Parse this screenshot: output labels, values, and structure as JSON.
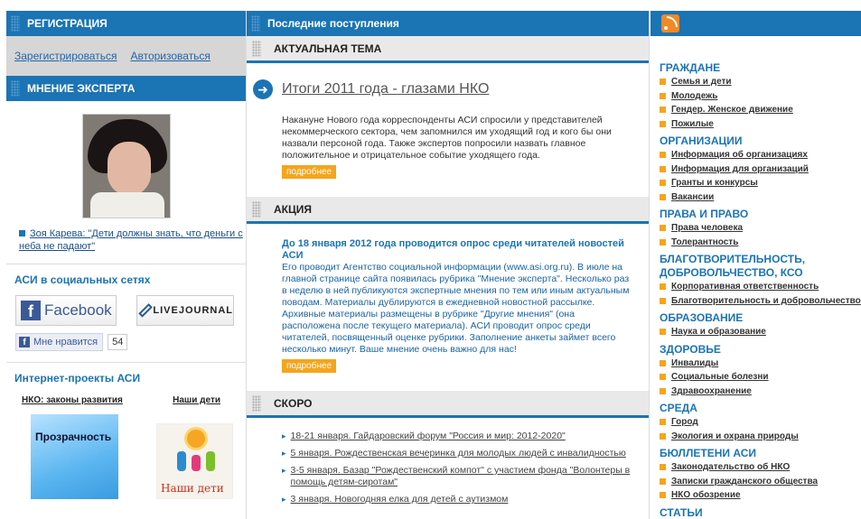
{
  "left": {
    "registration": {
      "title": "РЕГИСТРАЦИЯ",
      "register_link": "Зарегистрироваться",
      "login_link": "Авторизоваться"
    },
    "expert": {
      "title": "МНЕНИЕ ЭКСПЕРТА",
      "quote_link": "Зоя Карева: \"Дети должны знать, что деньги с неба не падают\""
    },
    "social": {
      "title": "АСИ в социальных сетях",
      "facebook_label": "Facebook",
      "livejournal_label": "LIVEJOURNAL",
      "like_label": "Мне нравится",
      "like_count": "54"
    },
    "projects": {
      "title": "Интернет-проекты АСИ",
      "link1": "НКО: законы развития",
      "link2": "Наши дети",
      "image1_text": "Прозрачность",
      "image2_text": "Наши дети"
    }
  },
  "middle": {
    "header": "Последние поступления",
    "topic": {
      "section": "АКТУАЛЬНАЯ ТЕМА",
      "title": "Итоги 2011 года - глазами НКО",
      "text": "Накануне Нового года корреспонденты АСИ спросили у представителей некоммерческого сектора, чем запомнился им уходящий год и кого бы они назвали персоной года. Также экспертов попросили назвать главное положительное и отрицательное событие уходящего года.",
      "more": "подробнее"
    },
    "action": {
      "section": "АКЦИЯ",
      "headline": "До 18 января 2012 года проводится опрос среди читателей новостей АСИ",
      "text": "Его проводит Агентство социальной информации (www.asi.org.ru). В июле на главной странице сайта появилась рубрика \"Мнение эксперта\". Несколько раз в неделю в ней публикуются экспертные мнения по тем или иным актуальным поводам. Материалы дублируются в ежедневной новостной рассылке. Архивные материалы размещены в рубрике \"Другие мнения\" (она расположена после текущего материала). АСИ проводит опрос среди читателей, посвященный оценке рубрики. Заполнение анкеты займет всего несколько минут. Ваше мнение очень важно для нас!",
      "more": "подробнее"
    },
    "soon": {
      "section": "СКОРО",
      "items": [
        "18-21 января. Гайдаровский форум \"Россия и мир: 2012-2020\"",
        "5 января. Рождественская вечеринка для молодых людей с инвалидностью",
        "3-5 января. Базар \"Рождественский компот\" с участием фонда \"Волонтеры в помощь детям-сиротам\"",
        "3 января. Новогодняя елка для детей с аутизмом"
      ]
    }
  },
  "right": {
    "categories": [
      {
        "title": "ГРАЖДАНЕ",
        "items": [
          "Семья и дети",
          "Молодежь",
          "Гендер. Женское движение",
          "Пожилые"
        ]
      },
      {
        "title": "ОРГАНИЗАЦИИ",
        "items": [
          "Информация об организациях",
          "Информация для организаций",
          "Гранты и конкурсы",
          "Вакансии"
        ]
      },
      {
        "title": "ПРАВА И ПРАВО",
        "items": [
          "Права человека",
          "Толерантность"
        ]
      },
      {
        "title": "БЛАГОТВОРИТЕЛЬНОСТЬ, ДОБРОВОЛЬЧЕСТВО, КСО",
        "items": [
          "Корпоративная ответственность",
          "Благотворительность и добровольчество"
        ]
      },
      {
        "title": "ОБРАЗОВАНИЕ",
        "items": [
          "Наука и образование"
        ]
      },
      {
        "title": "ЗДОРОВЬЕ",
        "items": [
          "Инвалиды",
          "Социальные болезни",
          "Здравоохранение"
        ]
      },
      {
        "title": "СРЕДА",
        "items": [
          "Город",
          "Экология и охрана природы"
        ]
      },
      {
        "title": "БЮЛЛЕТЕНИ АСИ",
        "items": [
          "Законодательство об НКО",
          "Записки гражданского общества",
          "НКО обозрение"
        ]
      },
      {
        "title": "СТАТЬИ",
        "items": []
      }
    ]
  }
}
